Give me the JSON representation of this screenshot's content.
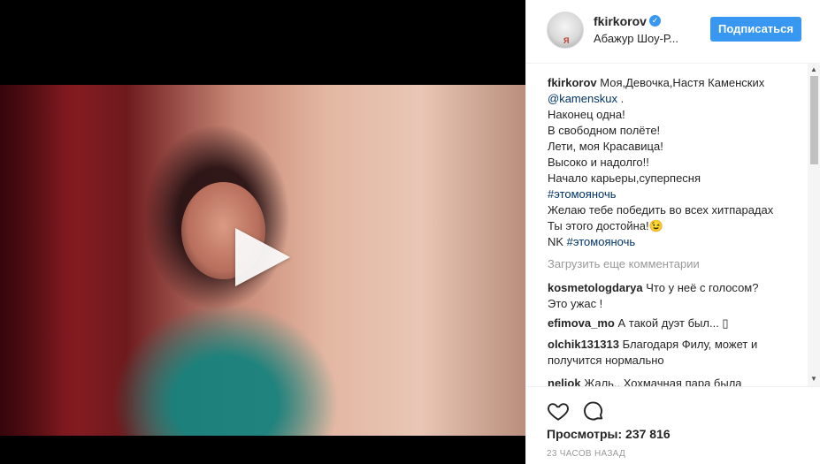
{
  "post": {
    "username": "fkirkorov",
    "verified_mark": "✓",
    "location": "Абажур Шоу-Р...",
    "follow_label": "Подписаться",
    "avatar_text": "Я"
  },
  "caption": {
    "username": "fkirkorov",
    "line1_text": " Моя,Девочка,Настя Каменских",
    "mention": "@kamenskux",
    "mention_suffix": " .",
    "lines": [
      "Наконец одна!",
      "В свободном полёте!",
      "Лети, моя Красавица!",
      "Высоко и надолго!!",
      "Начало карьеры,суперпесня"
    ],
    "hashtag1": "#этомояночь",
    "line_wish": "Желаю тебе победить во всех хитпарадах",
    "line_worthy": "Ты этого достойна!😉",
    "nk_prefix": "NK ",
    "hashtag2": "#этомояночь"
  },
  "load_more_label": "Загрузить еще комментарии",
  "comments": [
    {
      "user": "kosmetologdarya",
      "text": " Что у неё с голосом?",
      "text2": "Это ужас !"
    },
    {
      "user": "efimova_mo",
      "text": " А такой дуэт был... ▯",
      "text2": ""
    },
    {
      "user": "olchik131313",
      "text": " Благодаря Филу, может и",
      "text2": "получится нормально"
    },
    {
      "user": "neliok",
      "text": " Жаль.. Хохмачная пара была",
      "text2": ""
    }
  ],
  "footer": {
    "views_label": "Просмотры:",
    "views_count": " 237 816",
    "time": "23 ЧАСОВ НАЗАД"
  },
  "icons": {
    "like": "heart-icon",
    "comment": "comment-icon",
    "play": "play-icon",
    "verified": "verified-badge-icon"
  },
  "colors": {
    "accent": "#3897f0",
    "link": "#003569",
    "muted": "#999999"
  }
}
